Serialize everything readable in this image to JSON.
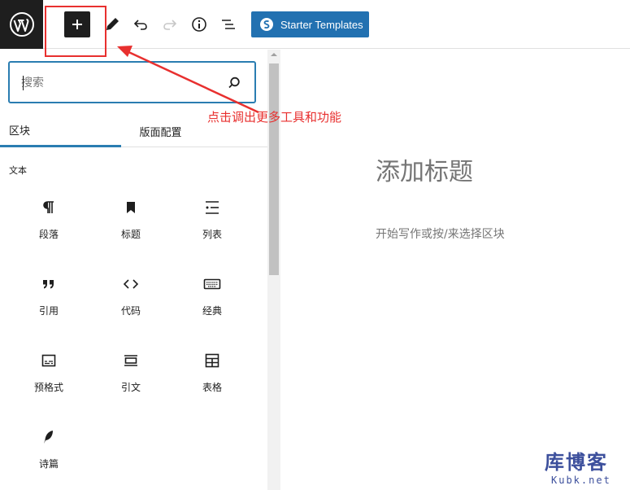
{
  "toolbar": {
    "starter_templates_label": "Starter Templates"
  },
  "annotation": {
    "text": "点击调出更多工具和功能",
    "color": "#e8302f"
  },
  "inserter": {
    "search_placeholder": "搜索",
    "tabs": [
      "区块",
      "版面配置"
    ],
    "section_title": "文本",
    "blocks": [
      {
        "label": "段落",
        "icon": "paragraph-icon"
      },
      {
        "label": "标题",
        "icon": "heading-bookmark-icon"
      },
      {
        "label": "列表",
        "icon": "list-icon"
      },
      {
        "label": "引用",
        "icon": "quote-icon"
      },
      {
        "label": "代码",
        "icon": "code-icon"
      },
      {
        "label": "经典",
        "icon": "keyboard-icon"
      },
      {
        "label": "预格式",
        "icon": "preformatted-icon"
      },
      {
        "label": "引文",
        "icon": "pullquote-icon"
      },
      {
        "label": "表格",
        "icon": "table-icon"
      },
      {
        "label": "诗篇",
        "icon": "verse-feather-icon"
      }
    ]
  },
  "editor": {
    "title_placeholder": "添加标题",
    "body_placeholder": "开始写作或按/来选择区块"
  },
  "watermark": {
    "cn": "库博客",
    "en": "Kubk.net"
  },
  "colors": {
    "accent": "#2a7db1",
    "starter_button": "#2271b1",
    "dark": "#1e1e1e",
    "annotation_red": "#e8302f",
    "watermark": "#3c4f9c"
  }
}
